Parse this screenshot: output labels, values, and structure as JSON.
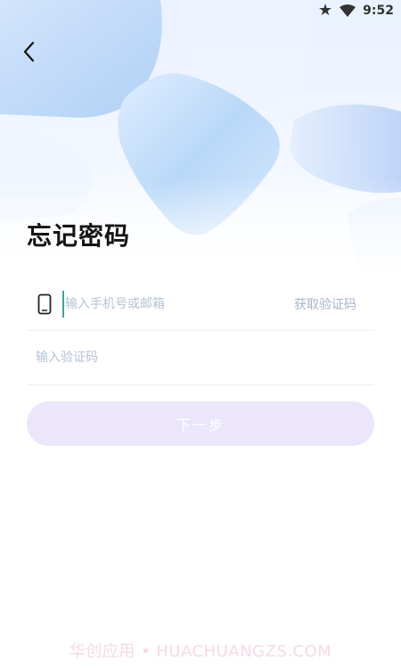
{
  "status_bar": {
    "time": "9:52",
    "icons": [
      "star-icon",
      "wifi-icon"
    ]
  },
  "header": {
    "back_icon": "chevron-left-icon",
    "title": "忘记密码"
  },
  "form": {
    "phone": {
      "icon": "phone-icon",
      "placeholder": "输入手机号或邮箱",
      "value": ""
    },
    "get_code_label": "获取验证码",
    "code": {
      "placeholder": "输入验证码",
      "value": ""
    }
  },
  "actions": {
    "next_label": "下一步"
  },
  "watermark": "华创应用 • HUACHUANGZS.COM",
  "colors": {
    "title": "#141414",
    "button_bg": "#ebe6fb",
    "placeholder": "#b5c3d4",
    "cursor": "#3aa6a3"
  }
}
